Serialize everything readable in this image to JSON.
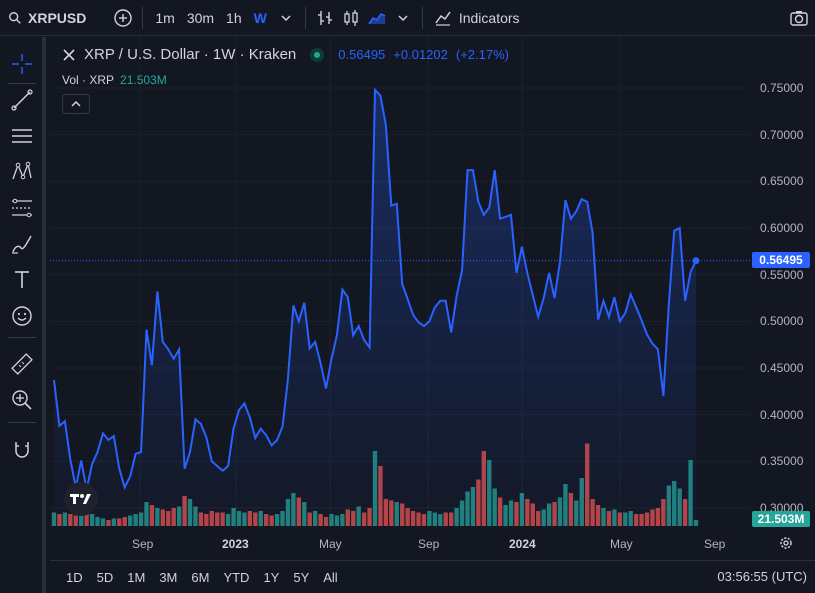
{
  "toolbar": {
    "symbol": "XRPUSD",
    "intervals": [
      "1m",
      "30m",
      "1h",
      "W"
    ],
    "active_interval": "W",
    "indicators_label": "Indicators"
  },
  "legend": {
    "title": "XRP / U.S. Dollar · 1W · Kraken",
    "price": "0.56495",
    "change": "+0.01202",
    "change_pct": "(+2.17%)",
    "vol_label": "Vol · XRP",
    "vol_value": "21.503M"
  },
  "price_axis": {
    "labels": [
      "0.75000",
      "0.70000",
      "0.65000",
      "0.60000",
      "0.55000",
      "0.50000",
      "0.45000",
      "0.40000",
      "0.35000",
      "0.30000"
    ],
    "last_price": "0.56495",
    "last_volume": "21.503M"
  },
  "time_axis": {
    "labels": [
      {
        "text": "Sep",
        "bold": false
      },
      {
        "text": "2023",
        "bold": true
      },
      {
        "text": "May",
        "bold": false
      },
      {
        "text": "Sep",
        "bold": false
      },
      {
        "text": "2024",
        "bold": true
      },
      {
        "text": "May",
        "bold": false
      },
      {
        "text": "Sep",
        "bold": false
      }
    ]
  },
  "bottom_bar": {
    "ranges": [
      "1D",
      "5D",
      "1M",
      "3M",
      "6M",
      "YTD",
      "1Y",
      "5Y",
      "All"
    ],
    "clock": "03:56:55 (UTC)"
  },
  "colors": {
    "line": "#2962ff",
    "up_volume": "#26a69a",
    "down_volume": "#ef5350",
    "background": "#131722"
  },
  "chart_data": {
    "type": "area",
    "ylim": [
      0.3,
      0.75
    ],
    "series": [
      {
        "values": [
          0.437,
          0.388,
          0.393,
          0.352,
          0.322,
          0.351,
          0.32,
          0.347,
          0.36,
          0.38,
          0.373,
          0.377,
          0.342,
          0.322,
          0.334,
          0.358,
          0.36,
          0.491,
          0.453,
          0.532,
          0.478,
          0.47,
          0.46,
          0.47,
          0.342,
          0.36,
          0.395,
          0.39,
          0.376,
          0.35,
          0.345,
          0.34,
          0.345,
          0.385,
          0.405,
          0.412,
          0.397,
          0.375,
          0.385,
          0.378,
          0.367,
          0.373,
          0.387,
          0.438,
          0.517,
          0.5,
          0.52,
          0.471,
          0.478,
          0.455,
          0.428,
          0.46,
          0.485,
          0.534,
          0.526,
          0.485,
          0.495,
          0.48,
          0.472,
          0.748,
          0.742,
          0.71,
          0.624,
          0.626,
          0.54,
          0.524,
          0.507,
          0.499,
          0.495,
          0.5,
          0.515,
          0.522,
          0.522,
          0.488,
          0.527,
          0.555,
          0.662,
          0.662,
          0.628,
          0.614,
          0.622,
          0.662,
          0.61,
          0.612,
          0.614,
          0.552,
          0.58,
          0.552,
          0.528,
          0.505,
          0.525,
          0.552,
          0.525,
          0.564,
          0.63,
          0.61,
          0.618,
          0.631,
          0.628,
          0.595,
          0.502,
          0.522,
          0.505,
          0.526,
          0.5,
          0.509,
          0.529,
          0.515,
          0.501,
          0.486,
          0.476,
          0.47,
          0.42,
          0.518,
          0.597,
          0.6,
          0.522,
          0.553,
          0.565
        ],
        "volumes_m": [
          9,
          8,
          9,
          8,
          7,
          11,
          9,
          8,
          6,
          5,
          4,
          5,
          5,
          6,
          7,
          8,
          9,
          16,
          14,
          12,
          11,
          10,
          12,
          13,
          20,
          18,
          13,
          9,
          8,
          10,
          9,
          9,
          8,
          12,
          10,
          9,
          10,
          9,
          10,
          8,
          7,
          8,
          10,
          18,
          22,
          19,
          16,
          9,
          10,
          8,
          6,
          8,
          7,
          8,
          11,
          10,
          13,
          9,
          12,
          50,
          40,
          18,
          17,
          16,
          15,
          12,
          10,
          9,
          8,
          10,
          9,
          8,
          9,
          9,
          12,
          17,
          23,
          26,
          31,
          50,
          44,
          25,
          19,
          14,
          17,
          16,
          22,
          18,
          15,
          10,
          11,
          15,
          16,
          19,
          28,
          22,
          17,
          32,
          55,
          18,
          14,
          12,
          10,
          11,
          9,
          9,
          10,
          8,
          8,
          9,
          11,
          12,
          18,
          27,
          30,
          25,
          18,
          44,
          4
        ],
        "volume_up": [
          1,
          0,
          1,
          0,
          0,
          1,
          0,
          1,
          1,
          1,
          0,
          1,
          0,
          0,
          1,
          1,
          1,
          1,
          0,
          1,
          0,
          0,
          0,
          1,
          0,
          1,
          1,
          0,
          0,
          0,
          0,
          0,
          1,
          1,
          1,
          1,
          0,
          0,
          1,
          0,
          0,
          1,
          1,
          1,
          1,
          0,
          1,
          0,
          1,
          0,
          0,
          1,
          1,
          1,
          0,
          0,
          1,
          0,
          0,
          1,
          0,
          0,
          0,
          1,
          0,
          0,
          0,
          0,
          0,
          1,
          1,
          1,
          0,
          0,
          1,
          1,
          1,
          1,
          0,
          0,
          1,
          1,
          0,
          1,
          1,
          0,
          1,
          0,
          0,
          0,
          1,
          1,
          0,
          1,
          1,
          0,
          1,
          1,
          0,
          0,
          0,
          1,
          0,
          1,
          0,
          1,
          1,
          0,
          0,
          0,
          0,
          0,
          0,
          1,
          1,
          1,
          0,
          1,
          1
        ]
      }
    ]
  }
}
